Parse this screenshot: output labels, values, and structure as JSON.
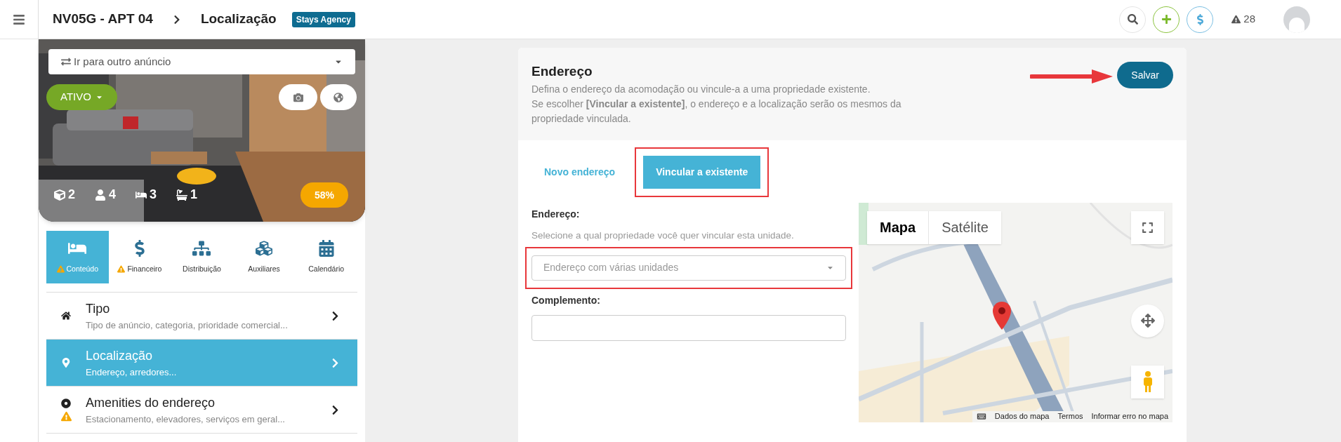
{
  "header": {
    "title": "NV05G - APT 04",
    "breadcrumb": "Localização",
    "badge": "Stays Agency",
    "alerts_count": "28"
  },
  "listing": {
    "switcher_placeholder": "Ir para outro anúncio",
    "status": "ATIVO",
    "completion": "58%",
    "stats": [
      {
        "kind": "rooms",
        "value": "2"
      },
      {
        "kind": "guests",
        "value": "4"
      },
      {
        "kind": "beds",
        "value": "3"
      },
      {
        "kind": "baths",
        "value": "1"
      }
    ]
  },
  "sections": [
    {
      "label": "Conteúdo",
      "kind": "bed",
      "warning": true,
      "selected": true
    },
    {
      "label": "Financeiro",
      "kind": "money",
      "warning": true,
      "selected": false
    },
    {
      "label": "Distribuição",
      "kind": "network",
      "warning": false,
      "selected": false
    },
    {
      "label": "Auxiliares",
      "kind": "boxes",
      "warning": false,
      "selected": false
    },
    {
      "label": "Calendário",
      "kind": "calendar",
      "warning": false,
      "selected": false
    }
  ],
  "menu": [
    {
      "title": "Tipo",
      "subtitle": "Tipo de anúncio, categoria, prioridade comercial...",
      "kind": "home",
      "warning": false,
      "selected": false
    },
    {
      "title": "Localização",
      "subtitle": "Endereço, arredores...",
      "kind": "pin",
      "warning": false,
      "selected": true
    },
    {
      "title": "Amenities do endereço",
      "subtitle": "Estacionamento, elevadores, serviços em geral...",
      "kind": "target",
      "warning": true,
      "selected": false
    }
  ],
  "address": {
    "title": "Endereço",
    "description": [
      "Defina o endereço da acomodação ou vincule-a a uma propriedade existente.",
      "Se escolher **[Vincular a existente]**, o endereço e a localização serão os mesmos da propriedade vinculada."
    ],
    "save": "Salvar",
    "modes": [
      {
        "label": "Novo endereço",
        "selected": false
      },
      {
        "label": "Vincular a existente",
        "selected": true
      }
    ],
    "address_label": "Endereço:",
    "address_hint": "Selecione a qual propriedade você quer vincular esta unidade.",
    "address_placeholder": "Endereço com várias unidades",
    "complement_label": "Complemento:",
    "map": {
      "types": [
        {
          "label": "Mapa",
          "selected": true
        },
        {
          "label": "Satélite",
          "selected": false
        }
      ],
      "attribution": [
        "Dados do mapa",
        "Termos",
        "Informar erro no mapa"
      ]
    }
  }
}
